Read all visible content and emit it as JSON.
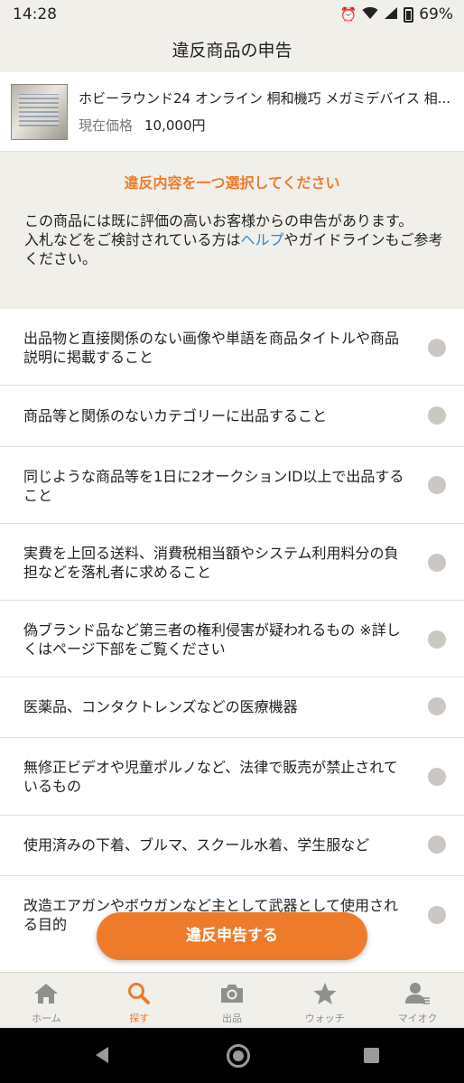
{
  "status_bar": {
    "time": "14:28",
    "battery": "69%",
    "icons": [
      "alarm-icon",
      "wifi-icon",
      "signal-icon",
      "battery-icon"
    ]
  },
  "header": {
    "title": "違反商品の申告"
  },
  "product": {
    "title": "ホビーラウンド24 オンライン 桐和機巧 メガミデバイス 相...",
    "price_label": "現在価格",
    "price_value": "10,000円"
  },
  "notice": {
    "heading": "違反内容を一つ選択してください",
    "line1": "この商品には既に評価の高いお客様からの申告があります。",
    "line2_before": "入札などをご検討されている方は",
    "help_link": "ヘルプ",
    "line2_after": "やガイドラインもご参考ください。"
  },
  "options": [
    {
      "label": "出品物と直接関係のない画像や単語を商品タイトルや商品説明に掲載すること"
    },
    {
      "label": "商品等と関係のないカテゴリーに出品すること"
    },
    {
      "label": "同じような商品等を1日に2オークションID以上で出品すること"
    },
    {
      "label": "実費を上回る送料、消費税相当額やシステム利用料分の負担などを落札者に求めること"
    },
    {
      "label": "偽ブランド品など第三者の権利侵害が疑われるもの ※詳しくはページ下部をご覧ください"
    },
    {
      "label": "医薬品、コンタクトレンズなどの医療機器"
    },
    {
      "label": "無修正ビデオや児童ポルノなど、法律で販売が禁止されているもの"
    },
    {
      "label": "使用済みの下着、ブルマ、スクール水着、学生服など"
    },
    {
      "label": "改造エアガンやボウガンなど主として武器として使用される目的"
    }
  ],
  "report_button": "違反申告する",
  "tabs": [
    {
      "label": "ホーム",
      "icon": "home-icon"
    },
    {
      "label": "探す",
      "icon": "search-icon"
    },
    {
      "label": "出品",
      "icon": "camera-icon"
    },
    {
      "label": "ウォッチ",
      "icon": "star-icon"
    },
    {
      "label": "マイオク",
      "icon": "user-icon"
    }
  ],
  "colors": {
    "accent": "#ee7b2a",
    "link": "#2f86d8",
    "header_bg": "#f1efe9",
    "radio": "#cbc8c4"
  }
}
